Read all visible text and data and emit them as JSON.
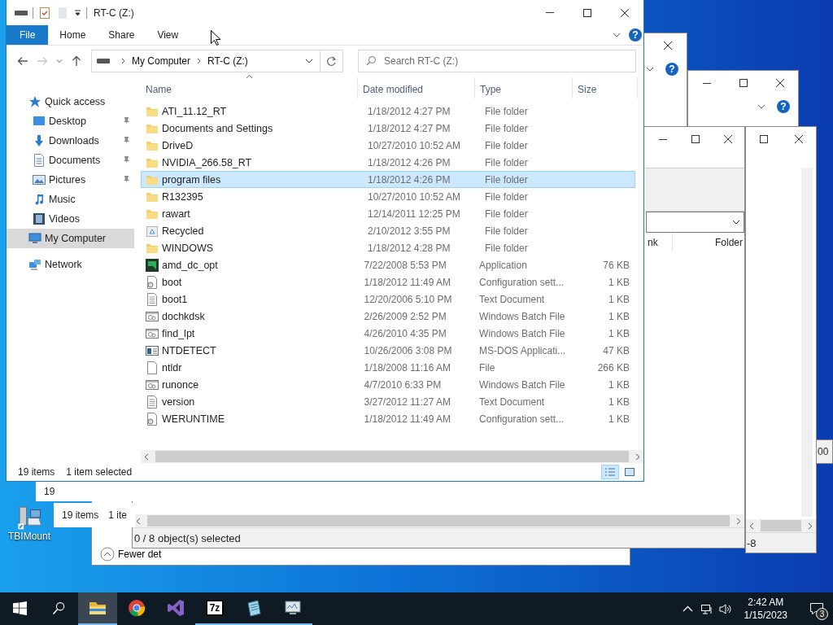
{
  "window": {
    "title": "RT-C (Z:)"
  },
  "ribbon_tabs": [
    {
      "label": "File",
      "selected": true
    },
    {
      "label": "Home",
      "selected": false
    },
    {
      "label": "Share",
      "selected": false
    },
    {
      "label": "View",
      "selected": false
    }
  ],
  "nav_buttons": [
    {
      "kind": "back",
      "disabled": false
    },
    {
      "kind": "forward",
      "disabled": true
    },
    {
      "kind": "recent",
      "disabled": false
    },
    {
      "kind": "up",
      "disabled": false
    }
  ],
  "address": {
    "crumbs": [
      "My Computer",
      "RT-C (Z:)"
    ]
  },
  "search": {
    "placeholder": "Search RT-C (Z:)"
  },
  "nav": {
    "items": [
      {
        "label": "Quick access",
        "kind": "star",
        "selected": false,
        "children": [
          {
            "label": "Desktop",
            "kind": "desktop",
            "pinned": true,
            "selected": false
          },
          {
            "label": "Downloads",
            "kind": "downloads",
            "pinned": true,
            "selected": false
          },
          {
            "label": "Documents",
            "kind": "documents",
            "pinned": true,
            "selected": false
          },
          {
            "label": "Pictures",
            "kind": "pictures",
            "pinned": true,
            "selected": false
          },
          {
            "label": "Music",
            "kind": "music",
            "pinned": false,
            "selected": false
          },
          {
            "label": "Videos",
            "kind": "videos",
            "pinned": false,
            "selected": false
          }
        ]
      },
      {
        "label": "My Computer",
        "kind": "computer",
        "selected": true
      },
      {
        "label": "Network",
        "kind": "network",
        "selected": false
      }
    ]
  },
  "ribbon_help": "?",
  "table": {
    "columns": [
      {
        "label": "Name",
        "sorted": true
      },
      {
        "label": "Date modified",
        "sorted": false
      },
      {
        "label": "Type",
        "sorted": false
      },
      {
        "label": "Size",
        "sorted": false
      }
    ],
    "rows": [
      {
        "name": "ATI_11.12_RT",
        "kind": "folder",
        "date": "1/18/2012 4:27 PM",
        "type": "File folder",
        "selected": false
      },
      {
        "name": "Documents and Settings",
        "kind": "folder",
        "date": "1/18/2012 4:27 PM",
        "type": "File folder",
        "selected": false
      },
      {
        "name": "DriveD",
        "kind": "folder",
        "date": "10/27/2010 10:52 AM",
        "type": "File folder",
        "selected": false
      },
      {
        "name": "NVIDIA_266.58_RT",
        "kind": "folder",
        "date": "1/18/2012 4:26 PM",
        "type": "File folder",
        "selected": false
      },
      {
        "name": "program files",
        "kind": "folder",
        "date": "1/18/2012 4:26 PM",
        "type": "File folder",
        "selected": true
      },
      {
        "name": "R132395",
        "kind": "folder",
        "date": "10/27/2010 10:52 AM",
        "type": "File folder",
        "selected": false
      },
      {
        "name": "rawart",
        "kind": "folder",
        "date": "12/14/2011 12:25 PM",
        "type": "File folder",
        "selected": false
      },
      {
        "name": "Recycled",
        "kind": "recycled",
        "date": "2/10/2012 3:55 PM",
        "type": "File folder",
        "selected": false
      },
      {
        "name": "WINDOWS",
        "kind": "folder",
        "date": "1/18/2012 4:28 PM",
        "type": "File folder",
        "selected": false
      },
      {
        "name": "amd_dc_opt",
        "kind": "application",
        "date": "7/22/2008 5:53 PM",
        "type": "Application",
        "size": "76 KB",
        "selected": false
      },
      {
        "name": "boot",
        "kind": "config",
        "date": "1/18/2012 11:49 AM",
        "type": "Configuration sett...",
        "size": "1 KB",
        "selected": false
      },
      {
        "name": "boot1",
        "kind": "text",
        "date": "12/20/2006 5:10 PM",
        "type": "Text Document",
        "size": "1 KB",
        "selected": false
      },
      {
        "name": "dochkdsk",
        "kind": "batch",
        "date": "2/26/2009 2:52 PM",
        "type": "Windows Batch File",
        "size": "1 KB",
        "selected": false
      },
      {
        "name": "find_lpt",
        "kind": "batch",
        "date": "4/26/2010 4:35 PM",
        "type": "Windows Batch File",
        "size": "1 KB",
        "selected": false
      },
      {
        "name": "NTDETECT",
        "kind": "msdos",
        "date": "10/26/2006 3:08 PM",
        "type": "MS-DOS Applicati...",
        "size": "47 KB",
        "selected": false
      },
      {
        "name": "ntldr",
        "kind": "file",
        "date": "1/18/2008 11:16 AM",
        "type": "File",
        "size": "266 KB",
        "selected": false
      },
      {
        "name": "runonce",
        "kind": "batch",
        "date": "4/7/2010 6:33 PM",
        "type": "Windows Batch File",
        "size": "1 KB",
        "selected": false
      },
      {
        "name": "version",
        "kind": "text",
        "date": "3/27/2012 11:27 AM",
        "type": "Text Document",
        "size": "1 KB",
        "selected": false
      },
      {
        "name": "WERUNTIME",
        "kind": "config",
        "date": "1/18/2012 11:49 AM",
        "type": "Configuration sett...",
        "size": "1 KB",
        "selected": false
      }
    ]
  },
  "status_bar": {
    "items": "19 items",
    "selection": "1 item selected"
  },
  "view_buttons": [
    {
      "kind": "details",
      "selected": true
    },
    {
      "kind": "large-icons",
      "selected": false
    }
  ],
  "background_windows": [
    {
      "kind": "caption",
      "buttons": [
        {
          "kind": "close"
        }
      ],
      "help": "?"
    },
    {
      "kind": "caption",
      "buttons": [
        {
          "kind": "minimize"
        },
        {
          "kind": "maximize"
        },
        {
          "kind": "close"
        }
      ],
      "help": "?"
    },
    {
      "kind": "explorer",
      "buttons": [
        {
          "kind": "minimize"
        },
        {
          "kind": "maximize"
        },
        {
          "kind": "close"
        }
      ],
      "columns": [
        "nk",
        "Folder"
      ],
      "status": "0 / 8 object(s) selected"
    },
    {
      "kind": "viewer",
      "buttons": [
        {
          "kind": "maximize"
        },
        {
          "kind": "close"
        }
      ],
      "status": "-8"
    },
    {
      "kind": "text",
      "texts": [
        "00"
      ]
    },
    {
      "kind": "status",
      "texts": [
        "19"
      ]
    },
    {
      "kind": "status",
      "texts": [
        "19 items",
        "1 ite"
      ]
    },
    {
      "kind": "dialog",
      "toggle": "Fewer det"
    }
  ],
  "desktop_icons": [
    {
      "label": "TBIMount"
    }
  ],
  "taskbar": {
    "buttons": [
      {
        "kind": "start"
      },
      {
        "kind": "search"
      }
    ],
    "apps": [
      {
        "kind": "folder",
        "running": true,
        "active": true
      },
      {
        "kind": "browser",
        "running": false,
        "active": false
      },
      {
        "kind": "ide",
        "running": false,
        "active": false
      },
      {
        "kind": "archiver",
        "label": "7z",
        "running": true,
        "active": false
      },
      {
        "kind": "notepad",
        "running": true,
        "active": false
      },
      {
        "kind": "monitor",
        "running": true,
        "active": false
      }
    ],
    "tray": [
      {
        "kind": "chevron"
      },
      {
        "kind": "network"
      },
      {
        "kind": "volume"
      }
    ],
    "clock": {
      "time": "2:42 AM",
      "date": "1/15/2023"
    },
    "notifications": "3"
  }
}
